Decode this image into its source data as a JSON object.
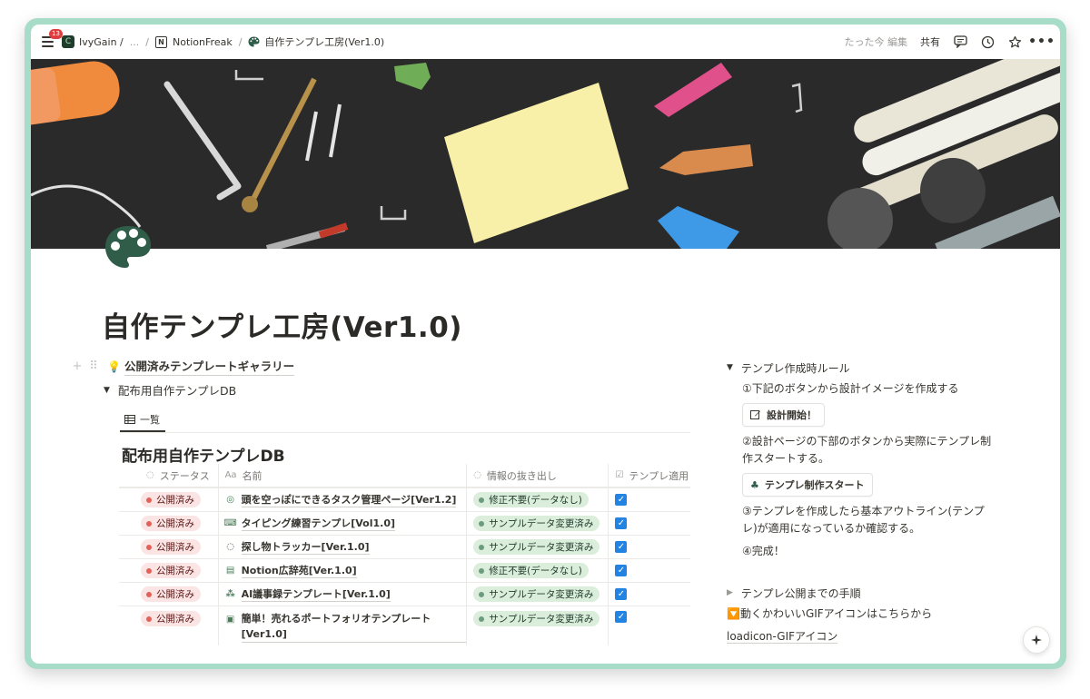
{
  "topbar": {
    "badge_count": "13",
    "workspace": "IvyGain /",
    "ellipsis": "...",
    "teamspace": "NotionFreak",
    "page": "自作テンプレ工房(Ver1.0)",
    "edited": "たった今 編集",
    "share": "共有"
  },
  "page": {
    "title": "自作テンプレ工房(Ver1.0)",
    "icon": "palette-icon"
  },
  "left": {
    "gallery_link": "公開済みテンプレートギャラリー",
    "db_toggle": "配布用自作テンプレDB",
    "view_tab": "一覧",
    "db_title": "配布用自作テンプレDB",
    "columns": [
      "ステータス",
      "名前",
      "情報の抜き出し",
      "テンプレ適用"
    ],
    "rows": [
      {
        "status": "公開済み",
        "name": "頭を空っぽにできるタスク管理ページ[Ver1.2]",
        "info": "修正不要(データなし)",
        "checked": true,
        "icon": "target-icon"
      },
      {
        "status": "公開済み",
        "name": "タイピング練習テンプレ[Vol1.0]",
        "info": "サンプルデータ変更済み",
        "checked": true,
        "icon": "keyboard-icon"
      },
      {
        "status": "公開済み",
        "name": "探し物トラッカー[Ver.1.0]",
        "info": "サンプルデータ変更済み",
        "checked": true,
        "icon": "dashed-circle-icon"
      },
      {
        "status": "公開済み",
        "name": "Notion広辞苑[Ver.1.0]",
        "info": "修正不要(データなし)",
        "checked": true,
        "icon": "book-icon"
      },
      {
        "status": "公開済み",
        "name": "AI議事録テンプレート[Ver.1.0]",
        "info": "サンプルデータ変更済み",
        "checked": true,
        "icon": "meeting-icon"
      },
      {
        "status": "公開済み",
        "name": "簡単！売れるポートフォリオテンプレート[Ver1.0]",
        "info": "サンプルデータ変更済み",
        "checked": true,
        "icon": "id-card-icon"
      }
    ]
  },
  "right": {
    "rules_toggle": "テンプレ作成時ルール",
    "step1": "①下記のボタンから設計イメージを作成する",
    "button1": "設計開始！",
    "step2": "②設計ページの下部のボタンから実際にテンプレ制作スタートする。",
    "button2": "テンプレ制作スタート",
    "step3": "③テンプレを作成したら基本アウトライン(テンプレ)が適用になっているか確認する。",
    "step4": "④完成！",
    "publish_toggle": "テンプレ公開までの手順",
    "gif_line": "🔽動くかわいいGIFアイコンはこちらから",
    "gif_link": "loadicon-GIFアイコン"
  },
  "colors": {
    "frame": "#a7dcc8",
    "status_red": "#fbe4e4",
    "info_green": "#dbeddb",
    "checkbox": "#2383e2"
  }
}
